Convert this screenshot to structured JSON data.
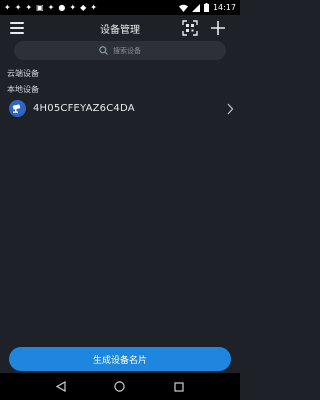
{
  "status_bar": {
    "time": "14:17",
    "notification_icons": [
      "bird-icon",
      "bird-icon",
      "bird-icon",
      "image-icon",
      "bird-icon",
      "pin-icon",
      "bird-icon",
      "android-icon",
      "bird-icon"
    ],
    "right_icons": [
      "wifi-icon",
      "signal-icon",
      "battery-icon"
    ]
  },
  "app_bar": {
    "title": "设备管理",
    "menu_icon": "hamburger-menu-icon",
    "scan_icon": "qr-scan-icon",
    "add_icon": "plus-icon"
  },
  "search": {
    "placeholder": "搜索设备",
    "icon": "search-icon"
  },
  "sections": {
    "cloud": "云端设备",
    "local": "本地设备"
  },
  "devices": [
    {
      "name": "4H05CFEYAZ6C4DA",
      "icon": "camera-device-icon"
    }
  ],
  "footer": {
    "generate_label": "生成设备名片"
  },
  "colors": {
    "background": "#1e2127",
    "search_bg": "#2c3037",
    "accent": "#1f86e0",
    "device_icon": "#2f66c4"
  }
}
